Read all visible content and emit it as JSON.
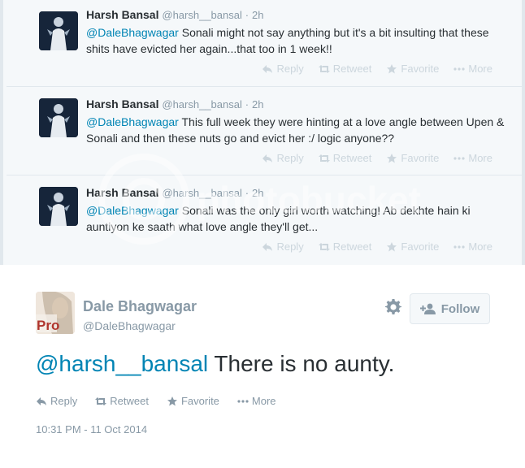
{
  "context_tweets": [
    {
      "fullname": "Harsh Bansal",
      "username": "@harsh__bansal",
      "dot": "·",
      "time": "2h",
      "mention": "@DaleBhagwagar",
      "text": " Sonali might not say anything but it's a bit insulting that these shits have evicted her again...that too in 1 week!!",
      "actions": {
        "reply": "Reply",
        "retweet": "Retweet",
        "favorite": "Favorite",
        "more": "More"
      }
    },
    {
      "fullname": "Harsh Bansal",
      "username": "@harsh__bansal",
      "dot": "·",
      "time": "2h",
      "mention": "@DaleBhagwagar",
      "text": " This full week they were hinting at a love angle between Upen & Sonali and then these nuts go and evict her :/ logic anyone??",
      "actions": {
        "reply": "Reply",
        "retweet": "Retweet",
        "favorite": "Favorite",
        "more": "More"
      }
    },
    {
      "fullname": "Harsh Bansal",
      "username": "@harsh__bansal",
      "dot": "·",
      "time": "2h",
      "mention": "@DaleBhagwagar",
      "text": " Sonali was the only girl worth watching! Ab dekhte hain ki auntiyon ke saath what love angle they'll get...",
      "actions": {
        "reply": "Reply",
        "retweet": "Retweet",
        "favorite": "Favorite",
        "more": "More"
      }
    }
  ],
  "main_tweet": {
    "fullname": "Dale Bhagwagar",
    "username": "@DaleBhagwagar",
    "follow_label": "Follow",
    "mention": "@harsh__bansal",
    "text": " There is no aunty.",
    "actions": {
      "reply": "Reply",
      "retweet": "Retweet",
      "favorite": "Favorite",
      "more": "More"
    },
    "timestamp": "10:31 PM - 11 Oct 2014",
    "avatar_badge": "Pro"
  },
  "watermark": "photobucket",
  "colors": {
    "link": "#0084b4",
    "muted": "#8899a6",
    "faded_action": "#ccd6dd",
    "context_bg": "#f5f8fa",
    "border": "#e1e8ed"
  }
}
